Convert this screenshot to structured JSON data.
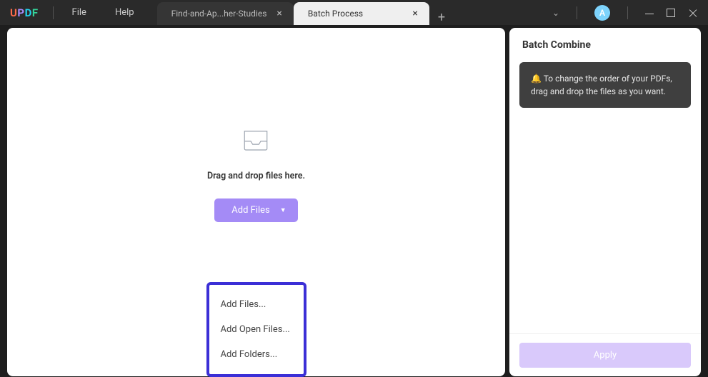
{
  "menu": {
    "file": "File",
    "help": "Help"
  },
  "tabs": {
    "inactive": "Find-and-Ap...her-Studies",
    "active": "Batch Process"
  },
  "avatar": "A",
  "main": {
    "drop_text": "Drag and drop files here.",
    "add_button": "Add Files",
    "dropdown": {
      "add_files": "Add Files...",
      "add_open": "Add Open Files...",
      "add_folders": "Add Folders..."
    }
  },
  "side": {
    "title": "Batch Combine",
    "tip_icon": "🔔",
    "tip_text": "To change the order of your PDFs, drag and drop the files as you want.",
    "apply": "Apply"
  }
}
